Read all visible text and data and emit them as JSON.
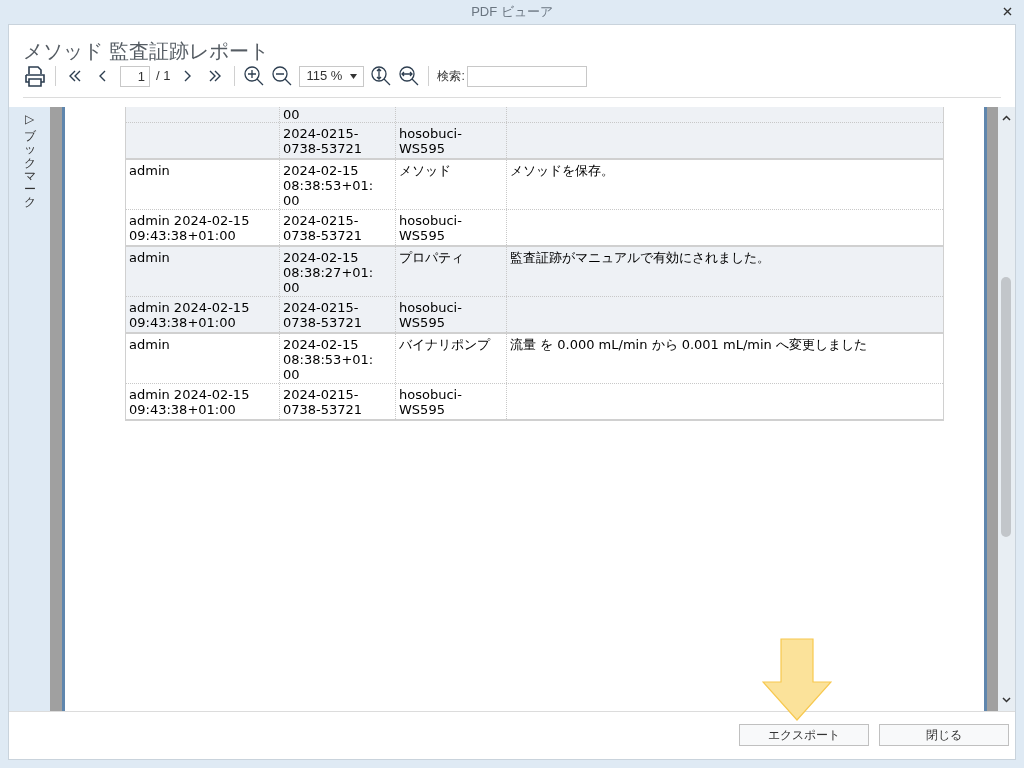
{
  "window": {
    "title": "PDF ビューア"
  },
  "report_title": "メソッド 監査証跡レポート",
  "toolbar": {
    "page_input": "1",
    "page_total": "/ 1",
    "zoom": "115 %",
    "search_label": "検索:"
  },
  "sidebar": {
    "label": "ブックマーク",
    "toggle": "▷"
  },
  "table": {
    "records": [
      {
        "date": "00",
        "sub": {
          "id": "2024-0215-\n0738-53721",
          "host": "hosobuci-\nWS595"
        }
      },
      {
        "user": "admin",
        "date": "2024-02-15\n08:38:53+01:\n00",
        "category": "メソッド",
        "description": "メソッドを保存。",
        "sub": {
          "signed": "admin 2024-02-15\n09:43:38+01:00",
          "id": "2024-0215-\n0738-53721",
          "host": "hosobuci-\nWS595"
        }
      },
      {
        "user": "admin",
        "date": "2024-02-15\n08:38:27+01:\n00",
        "category": "プロパティ",
        "description": "監査証跡がマニュアルで有効にされました。",
        "sub": {
          "signed": "admin 2024-02-15\n09:43:38+01:00",
          "id": "2024-0215-\n0738-53721",
          "host": "hosobuci-\nWS595"
        }
      },
      {
        "user": "admin",
        "date": "2024-02-15\n08:38:53+01:\n00",
        "category": "バイナリポンプ",
        "description": "流量 を 0.000 mL/min から 0.001 mL/min へ変更しました",
        "sub": {
          "signed": "admin 2024-02-15\n09:43:38+01:00",
          "id": "2024-0215-\n0738-53721",
          "host": "hosobuci-\nWS595"
        }
      }
    ]
  },
  "buttons": [
    {
      "label": "エクスポート"
    },
    {
      "label": "閉じる"
    }
  ]
}
